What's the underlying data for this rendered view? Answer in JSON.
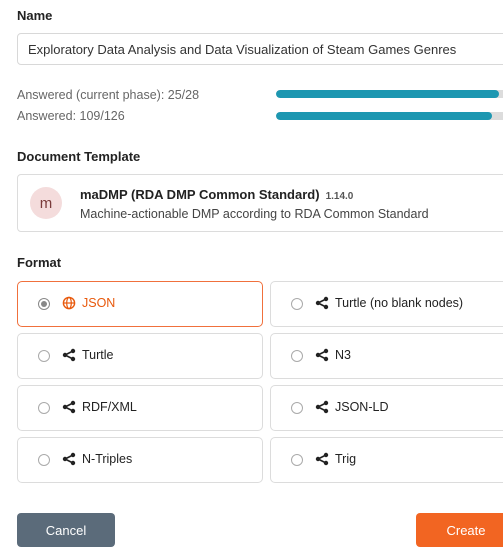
{
  "name_section": {
    "label": "Name",
    "value": "Exploratory Data Analysis and Data Visualization of Steam Games Genres"
  },
  "progress": {
    "current_phase_label": "Answered (current phase): 25/28",
    "current_phase_fraction": 0.893,
    "total_label": "Answered: 109/126",
    "total_fraction": 0.865,
    "color": "#1d97b1"
  },
  "template_section": {
    "label": "Document Template",
    "avatar_letter": "m",
    "name": "maDMP (RDA DMP Common Standard)",
    "version": "1.14.0",
    "description": "Machine-actionable DMP according to RDA Common Standard"
  },
  "format_section": {
    "label": "Format",
    "options": [
      {
        "label": "JSON",
        "icon": "globe-icon",
        "selected": true
      },
      {
        "label": "Turtle (no blank nodes)",
        "icon": "share-icon",
        "selected": false
      },
      {
        "label": "Turtle",
        "icon": "share-icon",
        "selected": false
      },
      {
        "label": "N3",
        "icon": "share-icon",
        "selected": false
      },
      {
        "label": "RDF/XML",
        "icon": "share-icon",
        "selected": false
      },
      {
        "label": "JSON-LD",
        "icon": "share-icon",
        "selected": false
      },
      {
        "label": "N-Triples",
        "icon": "share-icon",
        "selected": false
      },
      {
        "label": "Trig",
        "icon": "share-icon",
        "selected": false
      }
    ]
  },
  "actions": {
    "cancel_label": "Cancel",
    "create_label": "Create",
    "accent": "#f26522"
  }
}
